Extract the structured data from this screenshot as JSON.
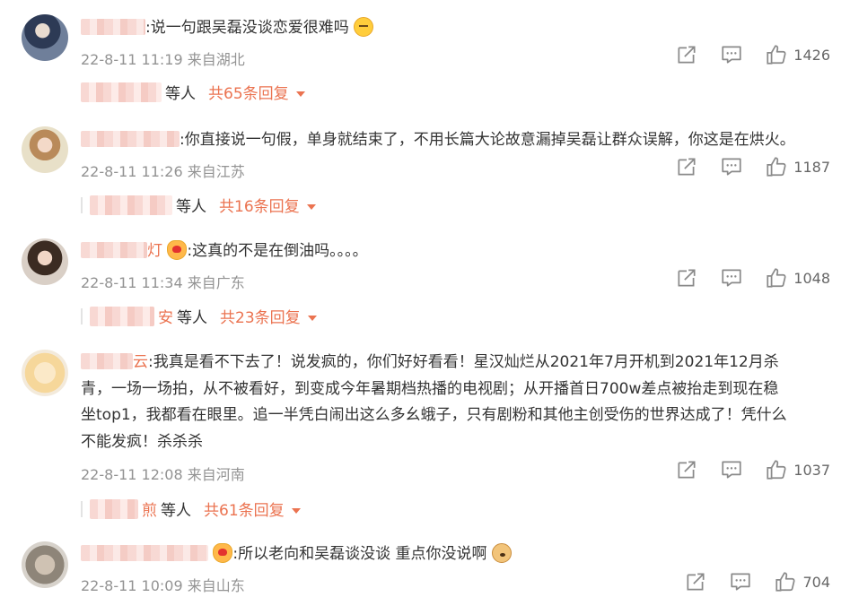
{
  "comments": [
    {
      "name_tail": "",
      "text": ":说一句跟吴磊没谈恋爱很难吗",
      "emoji": "smirk-emoji",
      "time": "22-8-11 11:19 来自湖北",
      "likes": "1426",
      "reply_tail": "",
      "reply_label": "等人",
      "reply_count": "共65条回复"
    },
    {
      "name_tail": "",
      "text": ":你直接说一句假，单身就结束了，不用长篇大论故意漏掉吴磊让群众误解，你这是在烘火。",
      "emoji": "",
      "time": "22-8-11 11:26 来自江苏",
      "likes": "1187",
      "reply_tail": "",
      "reply_label": "等人",
      "reply_count": "共16条回复"
    },
    {
      "name_tail": "灯",
      "text": ":这真的不是在倒油吗。。。。",
      "emoji": "heart-eyes-emoji",
      "time": "22-8-11 11:34 来自广东",
      "likes": "1048",
      "reply_tail": "安",
      "reply_label": "等人",
      "reply_count": "共23条回复"
    },
    {
      "name_tail": "云",
      "text_lines": [
        ":我真是看不下去了！说发疯的，你们好好看看！星汉灿烂从2021年7月开机到2021年12月杀",
        "青，一场一场拍，从不被看好，到变成今年暑期档热播的电视剧；从开播首日700w差点被抬走到现在稳",
        "坐top1，我都看在眼里。追一半凭白闹出这么多幺蛾子，只有剧粉和其他主创受伤的世界达成了！凭什么",
        "不能发疯！杀杀杀"
      ],
      "time": "22-8-11 12:08 来自河南",
      "likes": "1037",
      "reply_tail": "煎",
      "reply_label": "等人",
      "reply_count": "共61条回复"
    },
    {
      "name_tail": "",
      "text": ":所以老向和吴磊谈没谈 重点你没说啊",
      "emoji": "dog-emoji",
      "time": "22-8-11 10:09 来自山东",
      "likes": "704"
    }
  ],
  "icons": {
    "share": "share-icon",
    "comment": "comment-icon",
    "like": "like-icon",
    "caret": "caret-down-icon"
  },
  "colors": {
    "accent": "#eb7350",
    "meta": "#939393",
    "text": "#333333"
  }
}
